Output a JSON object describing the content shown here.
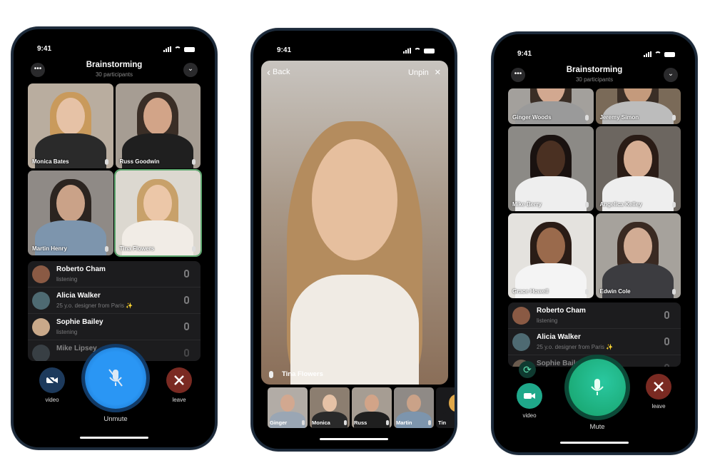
{
  "status_time": "9:41",
  "phone1": {
    "title": "Brainstorming",
    "subtitle": "30 participants",
    "more_icon": "•••",
    "collapse_icon": "⌄",
    "tiles": [
      {
        "name": "Monica Bates",
        "bg": "#b9ad9f",
        "skin": "#e6c2a6",
        "hair": "#c99a5c",
        "shirt": "#2a2a2a"
      },
      {
        "name": "Russ Goodwin",
        "bg": "#a69d93",
        "skin": "#d2a488",
        "hair": "#3a2e26",
        "shirt": "#1f1f1f"
      },
      {
        "name": "Martin Henry",
        "bg": "#8f8a86",
        "skin": "#caa288",
        "hair": "#2b2420",
        "shirt": "#7d95ad"
      },
      {
        "name": "Tina Flowers",
        "bg": "#dcd8d0",
        "skin": "#ecc7a8",
        "hair": "#c8a16a",
        "shirt": "#f1ece6"
      }
    ],
    "participants": [
      {
        "name": "Roberto Cham",
        "status": "listening",
        "avatar": "#8a5a44",
        "muted": false
      },
      {
        "name": "Alicia Walker",
        "status": "25 y.o. designer from Paris ✨",
        "avatar": "#4e6a72",
        "muted": false
      },
      {
        "name": "Sophie Bailey",
        "status": "listening",
        "avatar": "#c9a98a",
        "muted": true
      },
      {
        "name": "Mike Lipsey",
        "status": "",
        "avatar": "#5c6a74",
        "muted": false
      }
    ],
    "video_label": "video",
    "unmute_label": "Unmute",
    "leave_label": "leave",
    "colors": {
      "unmute": "#1d8cf0",
      "leave": "#7a2a22",
      "video": "#1d3a5c"
    }
  },
  "phone2": {
    "back_label": "Back",
    "unpin_label": "Unpin",
    "speaker_name": "Tina Flowers",
    "thumbs": [
      {
        "name": "Ginger",
        "bg": "#b2aca6",
        "skin": "#d2a890",
        "shirt": "#9aa6b4"
      },
      {
        "name": "Monica",
        "bg": "#8c7e70",
        "skin": "#e6c2a6",
        "shirt": "#2a2a2a"
      },
      {
        "name": "Russ",
        "bg": "#a69d93",
        "skin": "#d2a488",
        "shirt": "#1f1f1f"
      },
      {
        "name": "Martin",
        "bg": "#8f8a86",
        "skin": "#caa288",
        "shirt": "#7d95ad"
      },
      {
        "name": "Tin",
        "bg": "#1a1a1c",
        "skin": "#e0a84a",
        "shirt": "#1a1a1c"
      }
    ]
  },
  "phone3": {
    "title": "Brainstorming",
    "subtitle": "30 participants",
    "more_icon": "•••",
    "collapse_icon": "⌄",
    "tiles": [
      {
        "name": "Ginger Woods",
        "bg": "#a3a09c",
        "skin": "#d2a890",
        "hair": "#3a2e26",
        "shirt": "#9a9a9a"
      },
      {
        "name": "Jeremy Simon",
        "bg": "#7a6a58",
        "skin": "#c49a7c",
        "hair": "#3a2e26",
        "shirt": "#bcbcbc"
      },
      {
        "name": "Mike Berry",
        "bg": "#8c8a86",
        "skin": "#4a3022",
        "hair": "#1a1210",
        "shirt": "#eeeeee"
      },
      {
        "name": "Angelica Kelley",
        "bg": "#6c6660",
        "skin": "#d6ae94",
        "hair": "#2a1c16",
        "shirt": "#eeeeee"
      },
      {
        "name": "Grace Howell",
        "bg": "#e4e2de",
        "skin": "#9a6a4c",
        "hair": "#2a1c16",
        "shirt": "#f4f4f4"
      },
      {
        "name": "Edwin Cole",
        "bg": "#a6a29c",
        "skin": "#d2ac94",
        "hair": "#3a2a22",
        "shirt": "#3c3c40"
      }
    ],
    "participants": [
      {
        "name": "Roberto Cham",
        "status": "listening",
        "avatar": "#8a5a44",
        "muted": false
      },
      {
        "name": "Alicia Walker",
        "status": "25 y.o. designer from Paris ✨",
        "avatar": "#4e6a72",
        "muted": false
      },
      {
        "name": "Sophie Bailey",
        "status": "",
        "avatar": "#c9a98a",
        "muted": false
      }
    ],
    "video_label": "video",
    "mute_label": "Mute",
    "leave_label": "leave",
    "colors": {
      "mute": "#1fb87a",
      "leave": "#7a2a22",
      "video": "#1fa88a"
    }
  }
}
